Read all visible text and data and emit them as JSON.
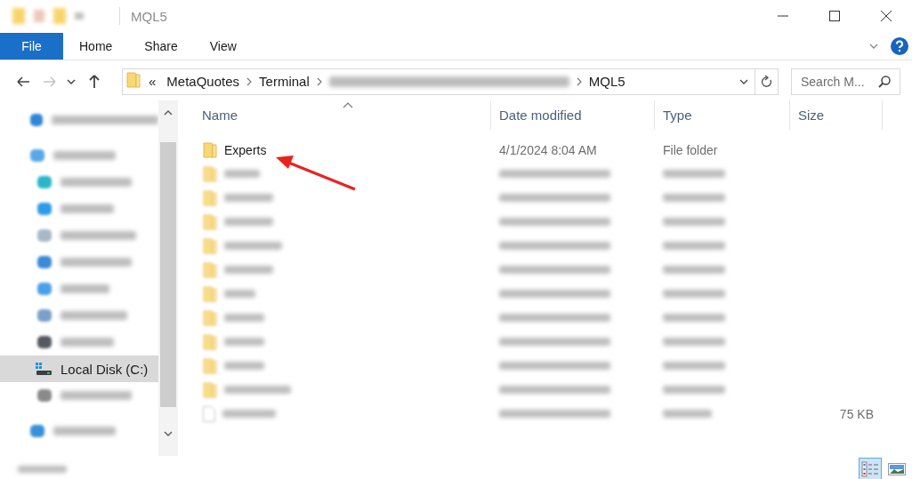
{
  "window": {
    "title": "MQL5"
  },
  "ribbon": {
    "tabs": [
      {
        "label": "File",
        "kind": "file_menu"
      },
      {
        "label": "Home",
        "kind": "tab"
      },
      {
        "label": "Share",
        "kind": "tab"
      },
      {
        "label": "View",
        "kind": "tab"
      }
    ]
  },
  "navigation": [
    {
      "kind": "back",
      "disabled": false
    },
    {
      "kind": "forward",
      "disabled": true
    },
    {
      "kind": "recent",
      "disabled": false
    },
    {
      "kind": "up",
      "disabled": false
    }
  ],
  "address": {
    "breadcrumbs": [
      {
        "kind": "overflow",
        "text": "«"
      },
      {
        "kind": "folder",
        "text": "MetaQuotes"
      },
      {
        "kind": "folder",
        "text": "Terminal"
      },
      {
        "kind": "blurred"
      },
      {
        "kind": "folder",
        "text": "MQL5"
      }
    ]
  },
  "search": {
    "placeholder": "Search M..."
  },
  "navigation_pane": {
    "items": [
      {
        "kind": "blurred",
        "color": "#2f86d8",
        "selected": false
      },
      {
        "kind": "blurred",
        "color": "#58a8e8",
        "selected": false,
        "children": [
          {
            "kind": "blurred",
            "color": "#2bb5c8",
            "selected": false
          },
          {
            "kind": "blurred",
            "color": "#2d9be8",
            "selected": false
          },
          {
            "kind": "blurred",
            "color": "#a8b8c8",
            "selected": false
          },
          {
            "kind": "blurred",
            "color": "#3a8ad8",
            "selected": false
          },
          {
            "kind": "blurred",
            "color": "#4aa0e8",
            "selected": false
          },
          {
            "kind": "blurred",
            "color": "#7aa0c8",
            "selected": false
          },
          {
            "kind": "blurred",
            "color": "#555a60",
            "selected": false
          },
          {
            "kind": "drive",
            "label": "Local Disk (C:)",
            "selected": true
          },
          {
            "kind": "blurred",
            "color": "#8a8a8a",
            "selected": false
          }
        ]
      },
      {
        "kind": "blurred",
        "color": "#3a90d8",
        "selected": false
      }
    ]
  },
  "file_list": {
    "columns": [
      {
        "label": "Name",
        "sorted": true
      },
      {
        "label": "Date modified",
        "sorted": false
      },
      {
        "label": "Type",
        "sorted": false
      },
      {
        "label": "Size",
        "sorted": false
      }
    ],
    "rows": [
      {
        "kind": "folder",
        "blurred": false,
        "name": "Experts",
        "date_modified": "4/1/2024 8:04 AM",
        "type": "File folder"
      },
      {
        "kind": "folder",
        "blurred": true
      },
      {
        "kind": "folder",
        "blurred": true
      },
      {
        "kind": "folder",
        "blurred": true
      },
      {
        "kind": "folder",
        "blurred": true
      },
      {
        "kind": "folder",
        "blurred": true
      },
      {
        "kind": "folder",
        "blurred": true
      },
      {
        "kind": "folder",
        "blurred": true
      },
      {
        "kind": "folder",
        "blurred": true
      },
      {
        "kind": "folder",
        "blurred": true
      },
      {
        "kind": "folder",
        "blurred": true
      },
      {
        "kind": "file",
        "blurred": true,
        "size": "75 KB"
      }
    ]
  },
  "annotation": {
    "kind": "arrow",
    "color": "#e8231f"
  },
  "status_bar": {
    "view_buttons": [
      {
        "kind": "details",
        "selected": true
      },
      {
        "kind": "large_icons",
        "selected": false
      }
    ]
  }
}
